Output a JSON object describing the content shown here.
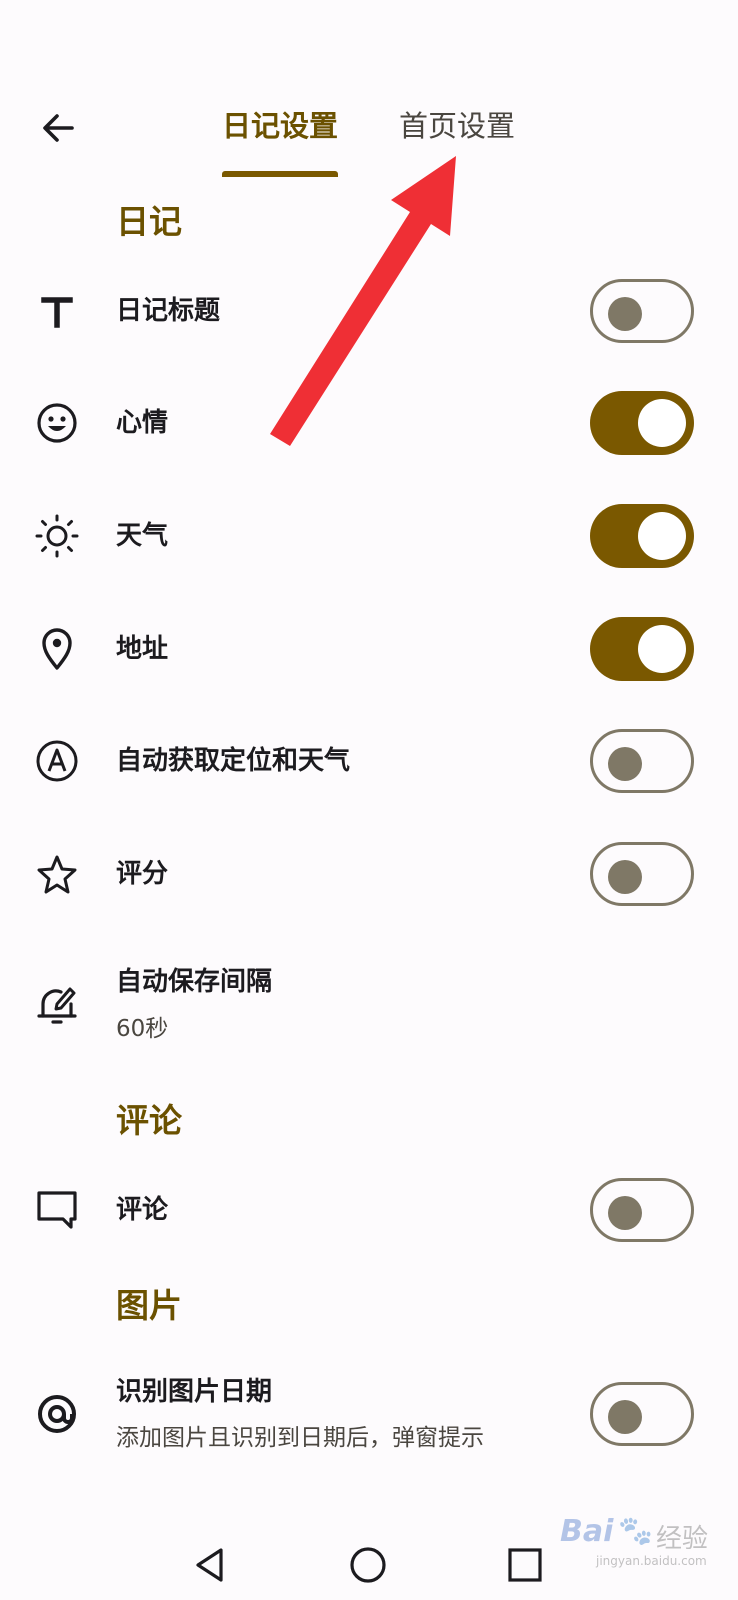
{
  "tabs": [
    {
      "label": "日记设置",
      "active": true
    },
    {
      "label": "首页设置",
      "active": false
    }
  ],
  "sections": {
    "diary": "日记",
    "comments": "评论",
    "images": "图片"
  },
  "settings": {
    "diary_title": {
      "label": "日记标题",
      "icon": "text-icon",
      "enabled": false
    },
    "mood": {
      "label": "心情",
      "icon": "smiley-icon",
      "enabled": true
    },
    "weather": {
      "label": "天气",
      "icon": "sun-icon",
      "enabled": true
    },
    "address": {
      "label": "地址",
      "icon": "location-pin-icon",
      "enabled": true
    },
    "auto_location_weather": {
      "label": "自动获取定位和天气",
      "icon": "auto-icon",
      "enabled": false
    },
    "rating": {
      "label": "评分",
      "icon": "star-icon",
      "enabled": false
    },
    "autosave_interval": {
      "label": "自动保存间隔",
      "value": "60秒",
      "icon": "alarm-edit-icon"
    },
    "comment": {
      "label": "评论",
      "icon": "comment-icon",
      "enabled": false
    },
    "recognize_image_date": {
      "label": "识别图片日期",
      "description": "添加图片且识别到日期后，弹窗提示",
      "icon": "at-icon",
      "enabled": false
    }
  },
  "colors": {
    "accent": "#7a5800",
    "section_title": "#6b5100",
    "toggle_off": "#7f7866",
    "arrow": "#ef2f35",
    "background": "#fdfbfd"
  },
  "nav": {
    "back": "back-triangle-icon",
    "home": "home-circle-icon",
    "recents": "recents-square-icon"
  },
  "watermark": {
    "text": "Bai",
    "text2": "经验",
    "subtext": "jingyan.baidu.com"
  }
}
